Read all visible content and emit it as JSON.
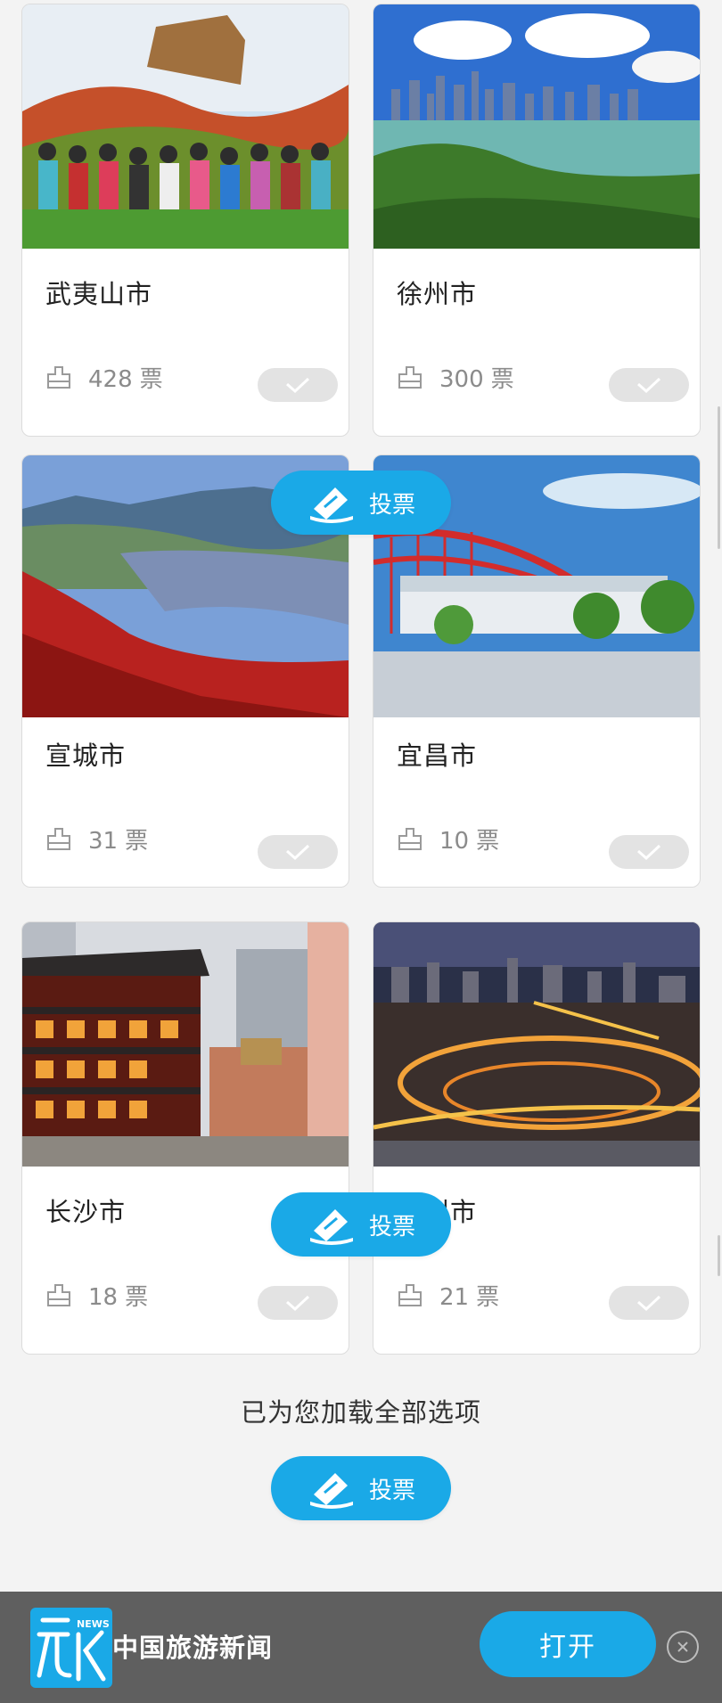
{
  "cards": [
    {
      "city": "武夷山市",
      "votes": "428",
      "unit": "票"
    },
    {
      "city": "徐州市",
      "votes": "300",
      "unit": "票"
    },
    {
      "city": "宣城市",
      "votes": "31",
      "unit": "票"
    },
    {
      "city": "宜昌市",
      "votes": "10",
      "unit": "票"
    },
    {
      "city": "长沙市",
      "votes": "18",
      "unit": "票"
    },
    {
      "city": "郑州市",
      "votes": "21",
      "unit": "票"
    }
  ],
  "vote_button": {
    "label": "投票"
  },
  "footer": {
    "loaded_all": "已为您加载全部选项"
  },
  "banner": {
    "app_name": "中国旅游新闻",
    "logo_text": "NEWS",
    "open_label": "打开"
  },
  "colors": {
    "accent": "#1aa9e7",
    "banner_bg": "#5f5f5f",
    "page_bg": "#f3f3f3"
  }
}
